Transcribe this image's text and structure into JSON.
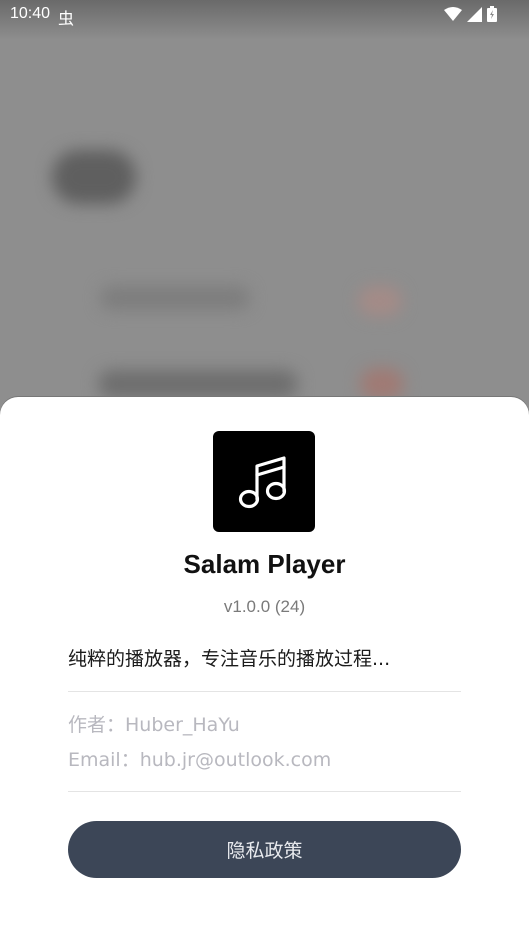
{
  "status_bar": {
    "time": "10:40",
    "notification_glyph": "虫",
    "icons": [
      "wifi-icon",
      "signal-icon",
      "battery-charging-icon"
    ]
  },
  "about_sheet": {
    "app_icon": "music-note-icon",
    "app_name": "Salam Player",
    "version": "v1.0.0 (24)",
    "description": "纯粹的播放器，专注音乐的播放过程...",
    "author_line": "作者：Huber_HaYu",
    "email_line": "Email：hub.jr@outlook.com",
    "privacy_button_label": "隐私政策"
  },
  "colors": {
    "sheet_background": "#ffffff",
    "button_background": "#3c4657",
    "button_text": "#e8eaee",
    "muted_text": "#b8b8bf",
    "version_text": "#7a7a7a",
    "scrim": "#8e8e8e"
  }
}
